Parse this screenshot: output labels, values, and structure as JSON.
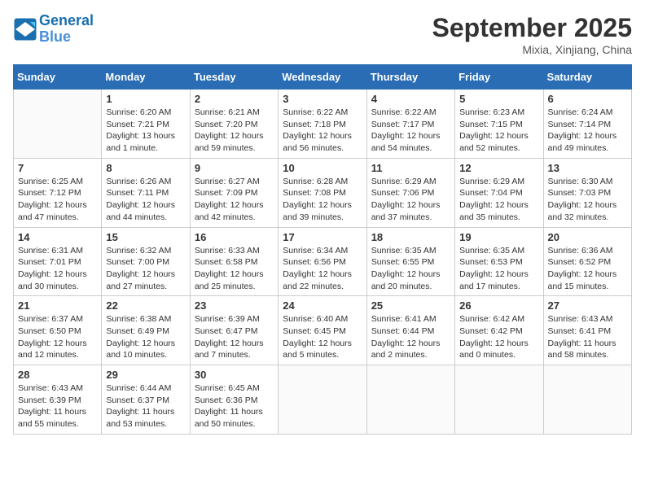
{
  "header": {
    "logo_line1": "General",
    "logo_line2": "Blue",
    "month": "September 2025",
    "location": "Mixia, Xinjiang, China"
  },
  "weekdays": [
    "Sunday",
    "Monday",
    "Tuesday",
    "Wednesday",
    "Thursday",
    "Friday",
    "Saturday"
  ],
  "weeks": [
    [
      {
        "day": "",
        "info": ""
      },
      {
        "day": "1",
        "info": "Sunrise: 6:20 AM\nSunset: 7:21 PM\nDaylight: 13 hours\nand 1 minute."
      },
      {
        "day": "2",
        "info": "Sunrise: 6:21 AM\nSunset: 7:20 PM\nDaylight: 12 hours\nand 59 minutes."
      },
      {
        "day": "3",
        "info": "Sunrise: 6:22 AM\nSunset: 7:18 PM\nDaylight: 12 hours\nand 56 minutes."
      },
      {
        "day": "4",
        "info": "Sunrise: 6:22 AM\nSunset: 7:17 PM\nDaylight: 12 hours\nand 54 minutes."
      },
      {
        "day": "5",
        "info": "Sunrise: 6:23 AM\nSunset: 7:15 PM\nDaylight: 12 hours\nand 52 minutes."
      },
      {
        "day": "6",
        "info": "Sunrise: 6:24 AM\nSunset: 7:14 PM\nDaylight: 12 hours\nand 49 minutes."
      }
    ],
    [
      {
        "day": "7",
        "info": "Sunrise: 6:25 AM\nSunset: 7:12 PM\nDaylight: 12 hours\nand 47 minutes."
      },
      {
        "day": "8",
        "info": "Sunrise: 6:26 AM\nSunset: 7:11 PM\nDaylight: 12 hours\nand 44 minutes."
      },
      {
        "day": "9",
        "info": "Sunrise: 6:27 AM\nSunset: 7:09 PM\nDaylight: 12 hours\nand 42 minutes."
      },
      {
        "day": "10",
        "info": "Sunrise: 6:28 AM\nSunset: 7:08 PM\nDaylight: 12 hours\nand 39 minutes."
      },
      {
        "day": "11",
        "info": "Sunrise: 6:29 AM\nSunset: 7:06 PM\nDaylight: 12 hours\nand 37 minutes."
      },
      {
        "day": "12",
        "info": "Sunrise: 6:29 AM\nSunset: 7:04 PM\nDaylight: 12 hours\nand 35 minutes."
      },
      {
        "day": "13",
        "info": "Sunrise: 6:30 AM\nSunset: 7:03 PM\nDaylight: 12 hours\nand 32 minutes."
      }
    ],
    [
      {
        "day": "14",
        "info": "Sunrise: 6:31 AM\nSunset: 7:01 PM\nDaylight: 12 hours\nand 30 minutes."
      },
      {
        "day": "15",
        "info": "Sunrise: 6:32 AM\nSunset: 7:00 PM\nDaylight: 12 hours\nand 27 minutes."
      },
      {
        "day": "16",
        "info": "Sunrise: 6:33 AM\nSunset: 6:58 PM\nDaylight: 12 hours\nand 25 minutes."
      },
      {
        "day": "17",
        "info": "Sunrise: 6:34 AM\nSunset: 6:56 PM\nDaylight: 12 hours\nand 22 minutes."
      },
      {
        "day": "18",
        "info": "Sunrise: 6:35 AM\nSunset: 6:55 PM\nDaylight: 12 hours\nand 20 minutes."
      },
      {
        "day": "19",
        "info": "Sunrise: 6:35 AM\nSunset: 6:53 PM\nDaylight: 12 hours\nand 17 minutes."
      },
      {
        "day": "20",
        "info": "Sunrise: 6:36 AM\nSunset: 6:52 PM\nDaylight: 12 hours\nand 15 minutes."
      }
    ],
    [
      {
        "day": "21",
        "info": "Sunrise: 6:37 AM\nSunset: 6:50 PM\nDaylight: 12 hours\nand 12 minutes."
      },
      {
        "day": "22",
        "info": "Sunrise: 6:38 AM\nSunset: 6:49 PM\nDaylight: 12 hours\nand 10 minutes."
      },
      {
        "day": "23",
        "info": "Sunrise: 6:39 AM\nSunset: 6:47 PM\nDaylight: 12 hours\nand 7 minutes."
      },
      {
        "day": "24",
        "info": "Sunrise: 6:40 AM\nSunset: 6:45 PM\nDaylight: 12 hours\nand 5 minutes."
      },
      {
        "day": "25",
        "info": "Sunrise: 6:41 AM\nSunset: 6:44 PM\nDaylight: 12 hours\nand 2 minutes."
      },
      {
        "day": "26",
        "info": "Sunrise: 6:42 AM\nSunset: 6:42 PM\nDaylight: 12 hours\nand 0 minutes."
      },
      {
        "day": "27",
        "info": "Sunrise: 6:43 AM\nSunset: 6:41 PM\nDaylight: 11 hours\nand 58 minutes."
      }
    ],
    [
      {
        "day": "28",
        "info": "Sunrise: 6:43 AM\nSunset: 6:39 PM\nDaylight: 11 hours\nand 55 minutes."
      },
      {
        "day": "29",
        "info": "Sunrise: 6:44 AM\nSunset: 6:37 PM\nDaylight: 11 hours\nand 53 minutes."
      },
      {
        "day": "30",
        "info": "Sunrise: 6:45 AM\nSunset: 6:36 PM\nDaylight: 11 hours\nand 50 minutes."
      },
      {
        "day": "",
        "info": ""
      },
      {
        "day": "",
        "info": ""
      },
      {
        "day": "",
        "info": ""
      },
      {
        "day": "",
        "info": ""
      }
    ]
  ]
}
